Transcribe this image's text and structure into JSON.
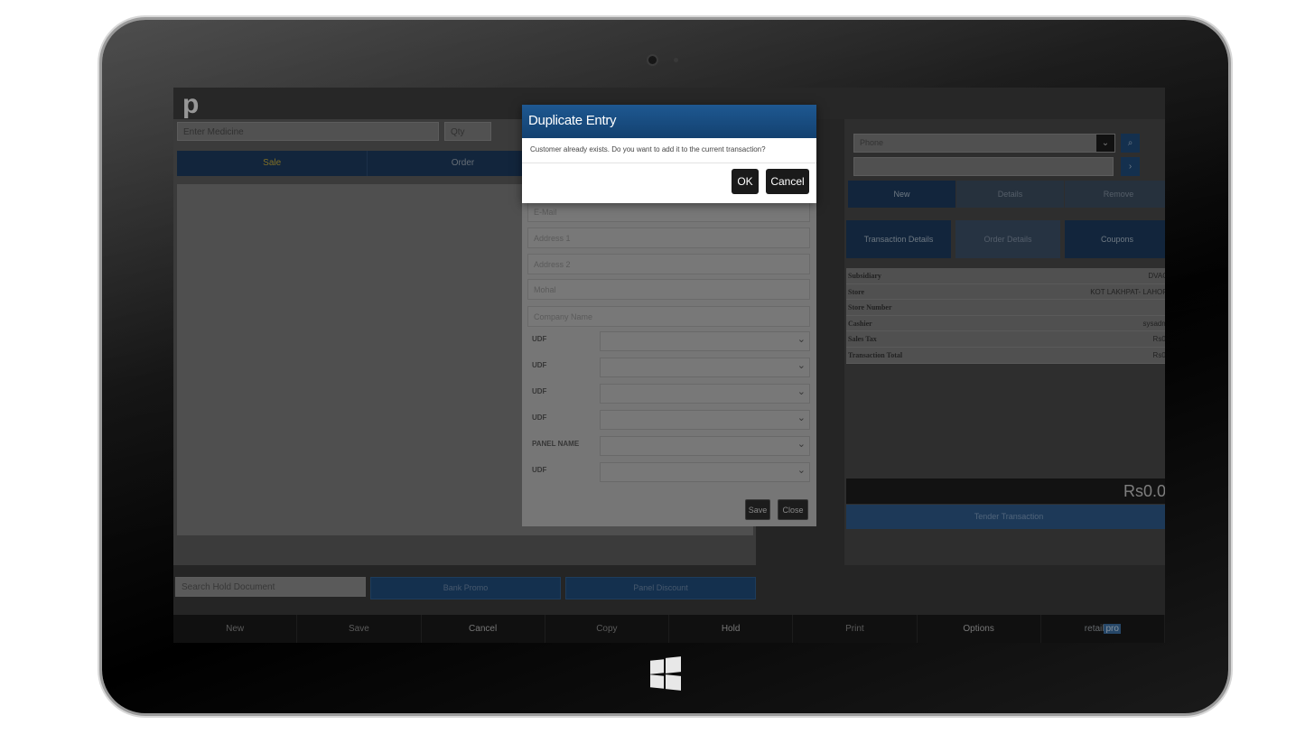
{
  "app": {
    "logo_letter": "p",
    "brand": {
      "prefix": "retail",
      "suffix": "pro"
    }
  },
  "search": {
    "medicine_placeholder": "Enter Medicine",
    "qty_placeholder": "Qty",
    "hold_placeholder": "Search Hold Document"
  },
  "tabs": [
    {
      "label": "Sale"
    },
    {
      "label": "Order"
    }
  ],
  "bottom_buttons": {
    "bank_promo": "Bank Promo",
    "panel_discount": "Panel Discount"
  },
  "footer": [
    "New",
    "Save",
    "Cancel",
    "Copy",
    "Hold",
    "Print",
    "Options"
  ],
  "customer_panel": {
    "phone_placeholder": "Phone",
    "actions": [
      "New",
      "Details",
      "Remove"
    ],
    "detail_tabs": [
      "Transaction Details",
      "Order Details",
      "Coupons"
    ],
    "info": [
      {
        "label": "Subsidiary",
        "value": "DVAC"
      },
      {
        "label": "Store",
        "value": "KOT LAKHPAT- LAHOR"
      },
      {
        "label": "Store Number",
        "value": ""
      },
      {
        "label": "Cashier",
        "value": "sysadm"
      },
      {
        "label": "Sales Tax",
        "value": "Rs0."
      },
      {
        "label": "Transaction Total",
        "value": "Rs0."
      }
    ],
    "total": "Rs0.0",
    "tender_label": "Tender Transaction"
  },
  "customer_form": {
    "fields": [
      "E-Mail",
      "Address 1",
      "Address 2",
      "Mohal",
      "Company Name"
    ],
    "udf_labels": [
      "UDF",
      "UDF",
      "UDF",
      "UDF",
      "PANEL NAME",
      "UDF"
    ],
    "save_label": "Save",
    "close_label": "Close"
  },
  "dialog": {
    "title": "Duplicate Entry",
    "message": "Customer already exists. Do you want to add it to the current transaction?",
    "ok_label": "OK",
    "cancel_label": "Cancel"
  },
  "colors": {
    "dialog_header": "#1e5891",
    "accent_blue": "#1d3a5c",
    "active_tab_text": "#c4a93a"
  }
}
